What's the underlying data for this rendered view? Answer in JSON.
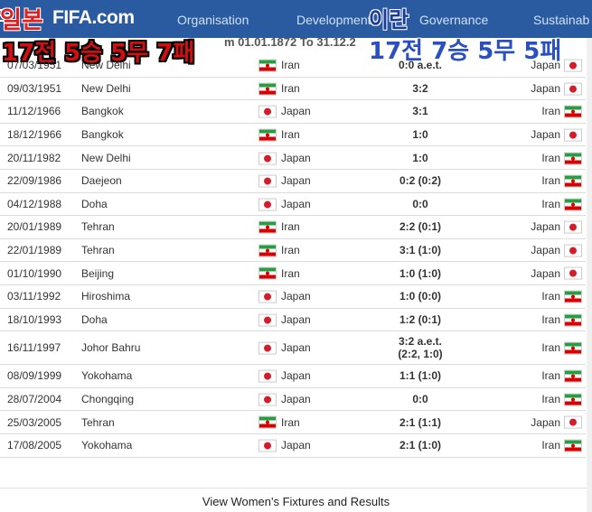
{
  "nav": {
    "logo": "FIFA.com",
    "items": [
      "Organisation",
      "Development",
      "Governance",
      "Sustainab"
    ]
  },
  "period": "m 01.01.1872 To 31.12.2",
  "overlay": {
    "left_title": "일본",
    "left_record": "17전 5승 5무 7패",
    "right_title": "이란",
    "right_record": "17전 7승 5무 5패"
  },
  "matches": [
    {
      "date": "07/03/1951",
      "venue": "New Delhi",
      "home": "Iran",
      "home_flag": "iran",
      "score": "0:0 a.e.t.",
      "away": "Japan",
      "away_flag": "japan"
    },
    {
      "date": "09/03/1951",
      "venue": "New Delhi",
      "home": "Iran",
      "home_flag": "iran",
      "score": "3:2",
      "away": "Japan",
      "away_flag": "japan"
    },
    {
      "date": "11/12/1966",
      "venue": "Bangkok",
      "home": "Japan",
      "home_flag": "japan",
      "score": "3:1",
      "away": "Iran",
      "away_flag": "iran"
    },
    {
      "date": "18/12/1966",
      "venue": "Bangkok",
      "home": "Iran",
      "home_flag": "iran",
      "score": "1:0",
      "away": "Japan",
      "away_flag": "japan"
    },
    {
      "date": "20/11/1982",
      "venue": "New Delhi",
      "home": "Japan",
      "home_flag": "japan",
      "score": "1:0",
      "away": "Iran",
      "away_flag": "iran"
    },
    {
      "date": "22/09/1986",
      "venue": "Daejeon",
      "home": "Japan",
      "home_flag": "japan",
      "score": "0:2 (0:2)",
      "away": "Iran",
      "away_flag": "iran"
    },
    {
      "date": "04/12/1988",
      "venue": "Doha",
      "home": "Japan",
      "home_flag": "japan",
      "score": "0:0",
      "away": "Iran",
      "away_flag": "iran"
    },
    {
      "date": "20/01/1989",
      "venue": "Tehran",
      "home": "Iran",
      "home_flag": "iran",
      "score": "2:2 (0:1)",
      "away": "Japan",
      "away_flag": "japan"
    },
    {
      "date": "22/01/1989",
      "venue": "Tehran",
      "home": "Iran",
      "home_flag": "iran",
      "score": "3:1 (1:0)",
      "away": "Japan",
      "away_flag": "japan"
    },
    {
      "date": "01/10/1990",
      "venue": "Beijing",
      "home": "Iran",
      "home_flag": "iran",
      "score": "1:0 (1:0)",
      "away": "Japan",
      "away_flag": "japan"
    },
    {
      "date": "03/11/1992",
      "venue": "Hiroshima",
      "home": "Japan",
      "home_flag": "japan",
      "score": "1:0 (0:0)",
      "away": "Iran",
      "away_flag": "iran"
    },
    {
      "date": "18/10/1993",
      "venue": "Doha",
      "home": "Japan",
      "home_flag": "japan",
      "score": "1:2 (0:1)",
      "away": "Iran",
      "away_flag": "iran"
    },
    {
      "date": "16/11/1997",
      "venue": "Johor Bahru",
      "home": "Japan",
      "home_flag": "japan",
      "score": "3:2 a.e.t.",
      "score2": "(2:2, 1:0)",
      "away": "Iran",
      "away_flag": "iran"
    },
    {
      "date": "08/09/1999",
      "venue": "Yokohama",
      "home": "Japan",
      "home_flag": "japan",
      "score": "1:1 (1:0)",
      "away": "Iran",
      "away_flag": "iran"
    },
    {
      "date": "28/07/2004",
      "venue": "Chongqing",
      "home": "Japan",
      "home_flag": "japan",
      "score": "0:0",
      "away": "Iran",
      "away_flag": "iran"
    },
    {
      "date": "25/03/2005",
      "venue": "Tehran",
      "home": "Iran",
      "home_flag": "iran",
      "score": "2:1 (1:1)",
      "away": "Japan",
      "away_flag": "japan"
    },
    {
      "date": "17/08/2005",
      "venue": "Yokohama",
      "home": "Japan",
      "home_flag": "japan",
      "score": "2:1 (1:0)",
      "away": "Iran",
      "away_flag": "iran"
    }
  ],
  "footer": {
    "link_label": "View Women's Fixtures and Results"
  }
}
